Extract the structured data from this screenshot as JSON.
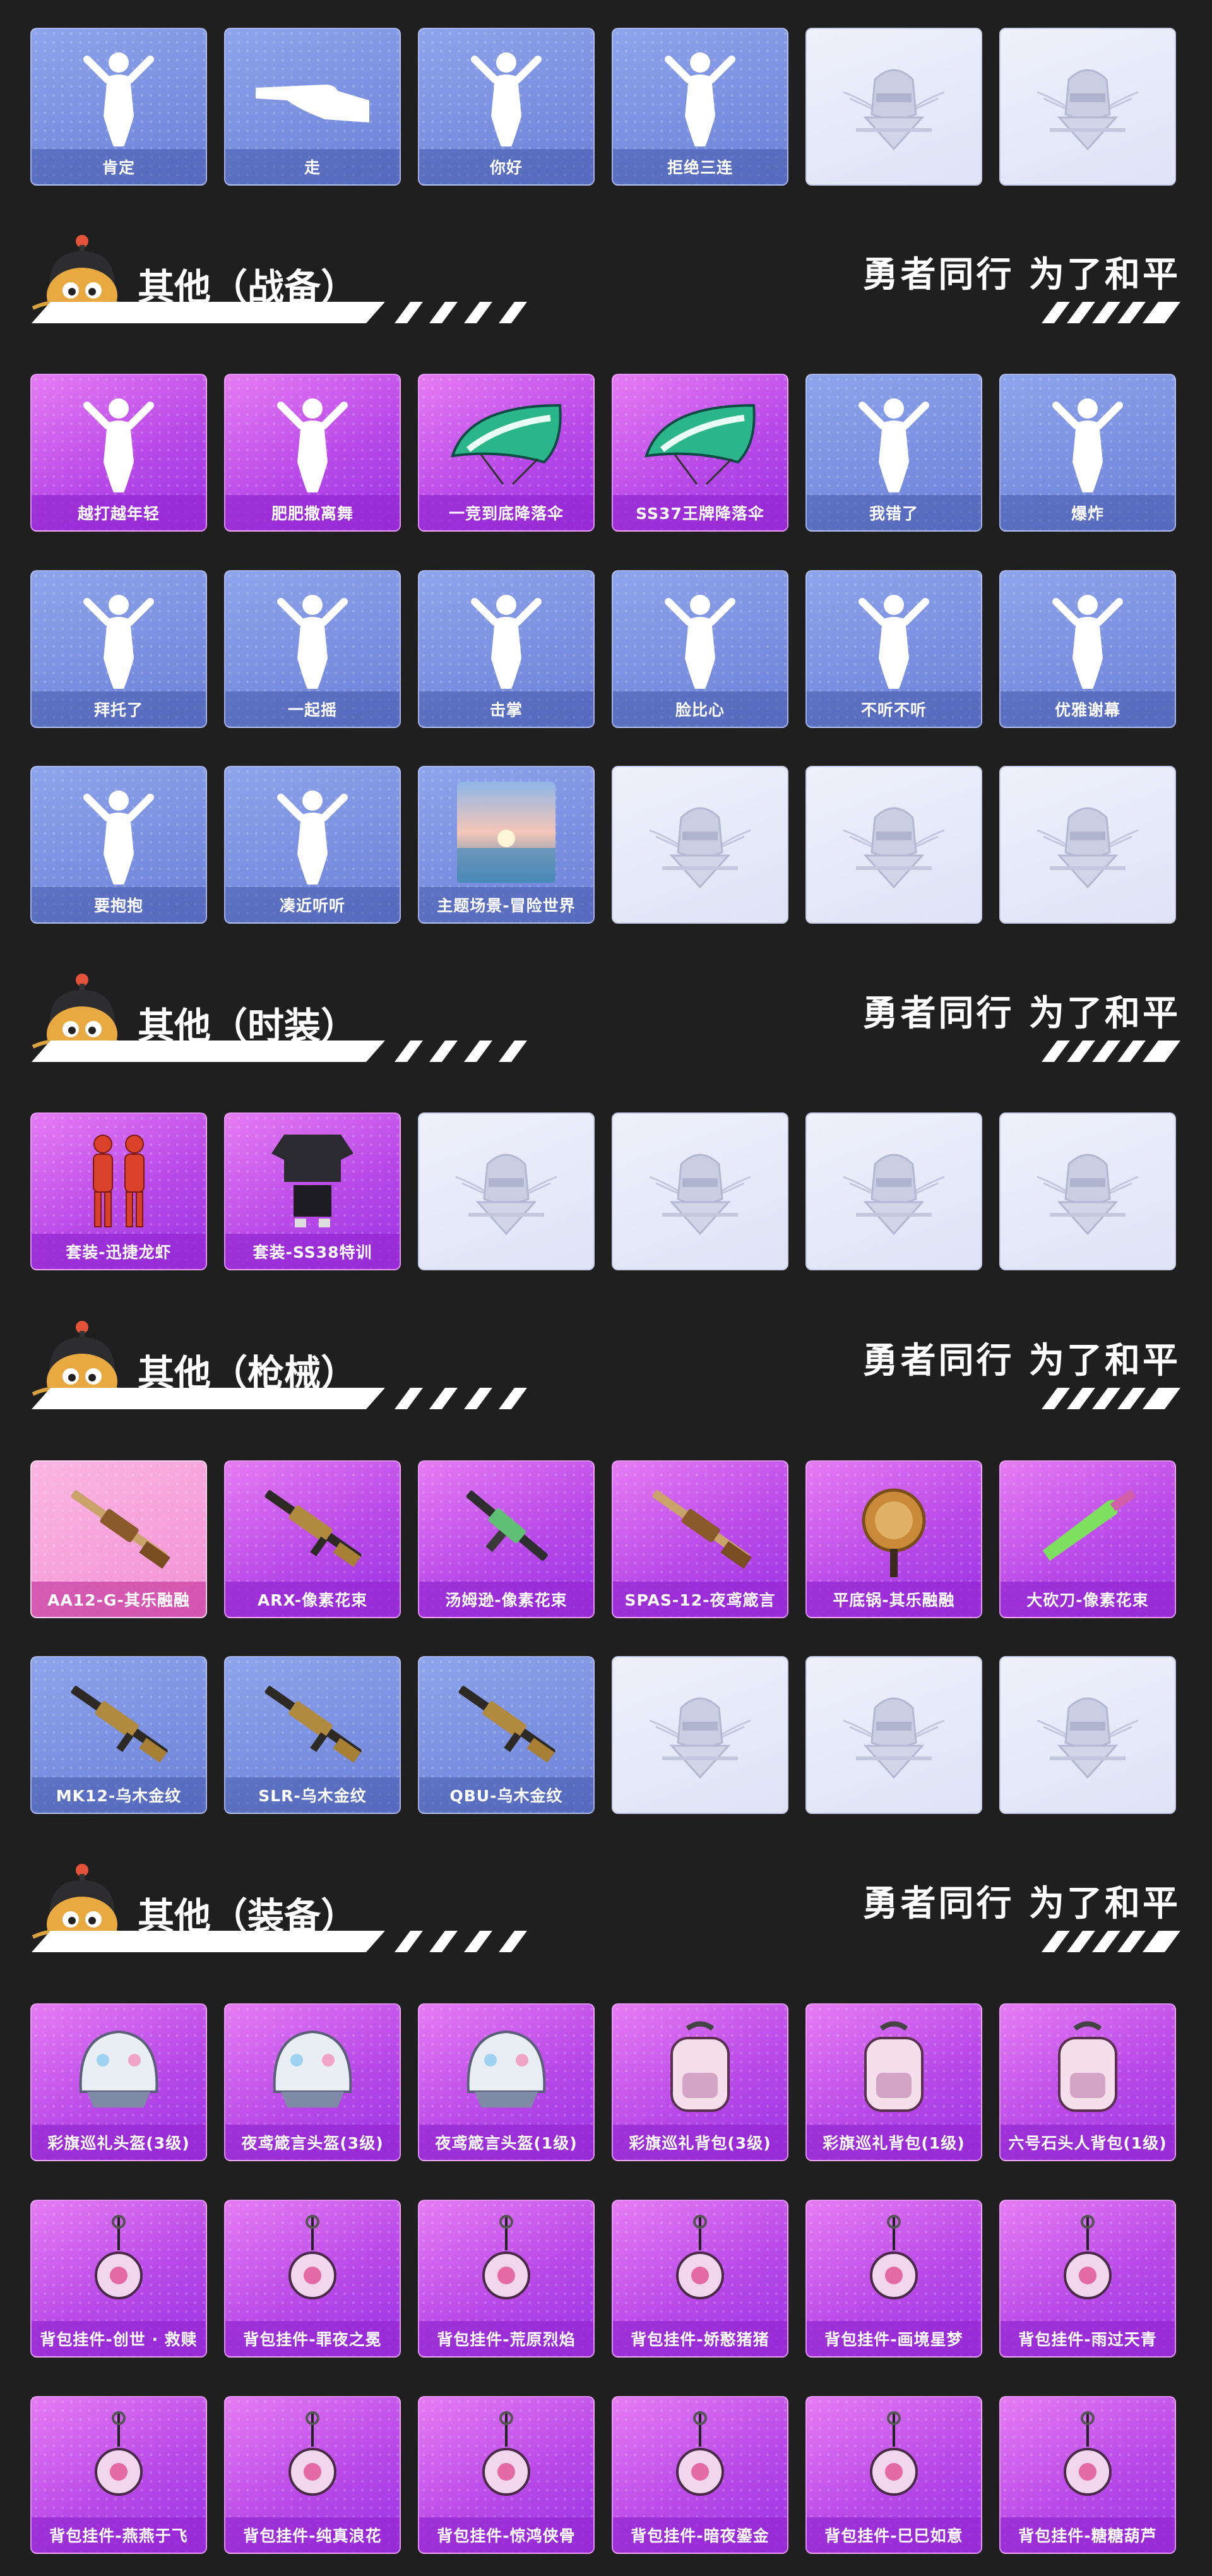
{
  "slogan": "勇者同行 为了和平",
  "colors": {
    "background": "#1f1f20",
    "card_blue": "#7f93e2",
    "card_purple": "#c95fed",
    "card_pink": "#f5a6dc",
    "card_empty": "#e6e9f7"
  },
  "top_row": [
    {
      "label": "肯定",
      "style": "blue",
      "icon": "emote-nod-icon"
    },
    {
      "label": "走",
      "style": "blue",
      "icon": "emote-point-icon"
    },
    {
      "label": "你好",
      "style": "blue",
      "icon": "emote-wave-icon"
    },
    {
      "label": "拒绝三连",
      "style": "blue",
      "icon": "emote-refuse-icon"
    },
    {
      "label": "",
      "style": "empty",
      "icon": "pubg-emblem-icon"
    },
    {
      "label": "",
      "style": "empty",
      "icon": "pubg-emblem-icon"
    }
  ],
  "sections": [
    {
      "title": "其他（战备）",
      "rows": [
        [
          {
            "label": "越打越年轻",
            "style": "purple",
            "icon": "emote-dance-icon"
          },
          {
            "label": "肥肥撒离舞",
            "style": "purple",
            "icon": "emote-sunhat-dance-icon"
          },
          {
            "label": "一竞到底降落伞",
            "style": "purple",
            "icon": "parachute-icon"
          },
          {
            "label": "SS37王牌降落伞",
            "style": "purple",
            "icon": "parachute-icon"
          },
          {
            "label": "我错了",
            "style": "blue",
            "icon": "emote-apology-icon"
          },
          {
            "label": "爆炸",
            "style": "blue",
            "icon": "emote-explode-icon"
          }
        ],
        [
          {
            "label": "拜托了",
            "style": "blue",
            "icon": "emote-pray-icon"
          },
          {
            "label": "一起摇",
            "style": "blue",
            "icon": "emote-shake-icon"
          },
          {
            "label": "击掌",
            "style": "blue",
            "icon": "emote-highfive-icon"
          },
          {
            "label": "脸比心",
            "style": "blue",
            "icon": "emote-heart-icon"
          },
          {
            "label": "不听不听",
            "style": "blue",
            "icon": "emote-cover-ears-icon"
          },
          {
            "label": "优雅谢幕",
            "style": "blue",
            "icon": "emote-bow-icon"
          }
        ],
        [
          {
            "label": "要抱抱",
            "style": "blue",
            "icon": "emote-hug-icon"
          },
          {
            "label": "凑近听听",
            "style": "blue",
            "icon": "emote-listen-icon"
          },
          {
            "label": "主题场景-冒险世界",
            "style": "blue",
            "icon": "scene-sunset-icon"
          },
          {
            "label": "",
            "style": "empty",
            "icon": "pubg-emblem-icon"
          },
          {
            "label": "",
            "style": "empty",
            "icon": "pubg-emblem-icon"
          },
          {
            "label": "",
            "style": "empty",
            "icon": "pubg-emblem-icon"
          }
        ]
      ]
    },
    {
      "title": "其他（时装）",
      "rows": [
        [
          {
            "label": "套装-迅捷龙虾",
            "style": "purple",
            "icon": "outfit-lobster-icon"
          },
          {
            "label": "套装-SS38特训",
            "style": "purple",
            "icon": "outfit-training-icon"
          },
          {
            "label": "",
            "style": "empty",
            "icon": "pubg-emblem-icon"
          },
          {
            "label": "",
            "style": "empty",
            "icon": "pubg-emblem-icon"
          },
          {
            "label": "",
            "style": "empty",
            "icon": "pubg-emblem-icon"
          },
          {
            "label": "",
            "style": "empty",
            "icon": "pubg-emblem-icon"
          }
        ]
      ]
    },
    {
      "title": "其他（枪械）",
      "rows": [
        [
          {
            "label": "AA12-G-其乐融融",
            "style": "pink",
            "icon": "shotgun-icon"
          },
          {
            "label": "ARX-像素花束",
            "style": "purple",
            "icon": "rifle-icon"
          },
          {
            "label": "汤姆逊-像素花束",
            "style": "purple",
            "icon": "smg-icon"
          },
          {
            "label": "SPAS-12-夜鸢箴言",
            "style": "purple",
            "icon": "shotgun-icon"
          },
          {
            "label": "平底锅-其乐融融",
            "style": "purple",
            "icon": "pan-icon"
          },
          {
            "label": "大砍刀-像素花束",
            "style": "purple",
            "icon": "machete-icon"
          }
        ],
        [
          {
            "label": "MK12-乌木金纹",
            "style": "blue",
            "icon": "rifle-icon"
          },
          {
            "label": "SLR-乌木金纹",
            "style": "blue",
            "icon": "rifle-icon"
          },
          {
            "label": "QBU-乌木金纹",
            "style": "blue",
            "icon": "rifle-icon"
          },
          {
            "label": "",
            "style": "empty",
            "icon": "pubg-emblem-icon"
          },
          {
            "label": "",
            "style": "empty",
            "icon": "pubg-emblem-icon"
          },
          {
            "label": "",
            "style": "empty",
            "icon": "pubg-emblem-icon"
          }
        ]
      ]
    },
    {
      "title": "其他（装备）",
      "rows": [
        [
          {
            "label": "彩旗巡礼头盔(3级)",
            "style": "purple",
            "icon": "helmet-icon"
          },
          {
            "label": "夜鸢箴言头盔(3级)",
            "style": "purple",
            "icon": "helmet-icon"
          },
          {
            "label": "夜鸢箴言头盔(1级)",
            "style": "purple",
            "icon": "helmet-icon"
          },
          {
            "label": "彩旗巡礼背包(3级)",
            "style": "purple",
            "icon": "backpack-icon"
          },
          {
            "label": "彩旗巡礼背包(1级)",
            "style": "purple",
            "icon": "backpack-icon"
          },
          {
            "label": "六号石头人背包(1级)",
            "style": "purple",
            "icon": "backpack-icon"
          }
        ],
        [
          {
            "label": "背包挂件-创世 · 救赎",
            "style": "purple",
            "icon": "charm-icon"
          },
          {
            "label": "背包挂件-罪夜之冕",
            "style": "purple",
            "icon": "charm-icon"
          },
          {
            "label": "背包挂件-荒原烈焰",
            "style": "purple",
            "icon": "charm-icon"
          },
          {
            "label": "背包挂件-娇憨猪猪",
            "style": "purple",
            "icon": "charm-icon"
          },
          {
            "label": "背包挂件-画境星梦",
            "style": "purple",
            "icon": "charm-icon"
          },
          {
            "label": "背包挂件-雨过天青",
            "style": "purple",
            "icon": "charm-icon"
          }
        ],
        [
          {
            "label": "背包挂件-燕燕于飞",
            "style": "purple",
            "icon": "charm-icon"
          },
          {
            "label": "背包挂件-纯真浪花",
            "style": "purple",
            "icon": "charm-icon"
          },
          {
            "label": "背包挂件-惊鸿侠骨",
            "style": "purple",
            "icon": "charm-icon"
          },
          {
            "label": "背包挂件-暗夜鎏金",
            "style": "purple",
            "icon": "charm-icon"
          },
          {
            "label": "背包挂件-巳巳如意",
            "style": "purple",
            "icon": "charm-icon"
          },
          {
            "label": "背包挂件-糖糖葫芦",
            "style": "purple",
            "icon": "charm-icon"
          }
        ]
      ]
    }
  ]
}
